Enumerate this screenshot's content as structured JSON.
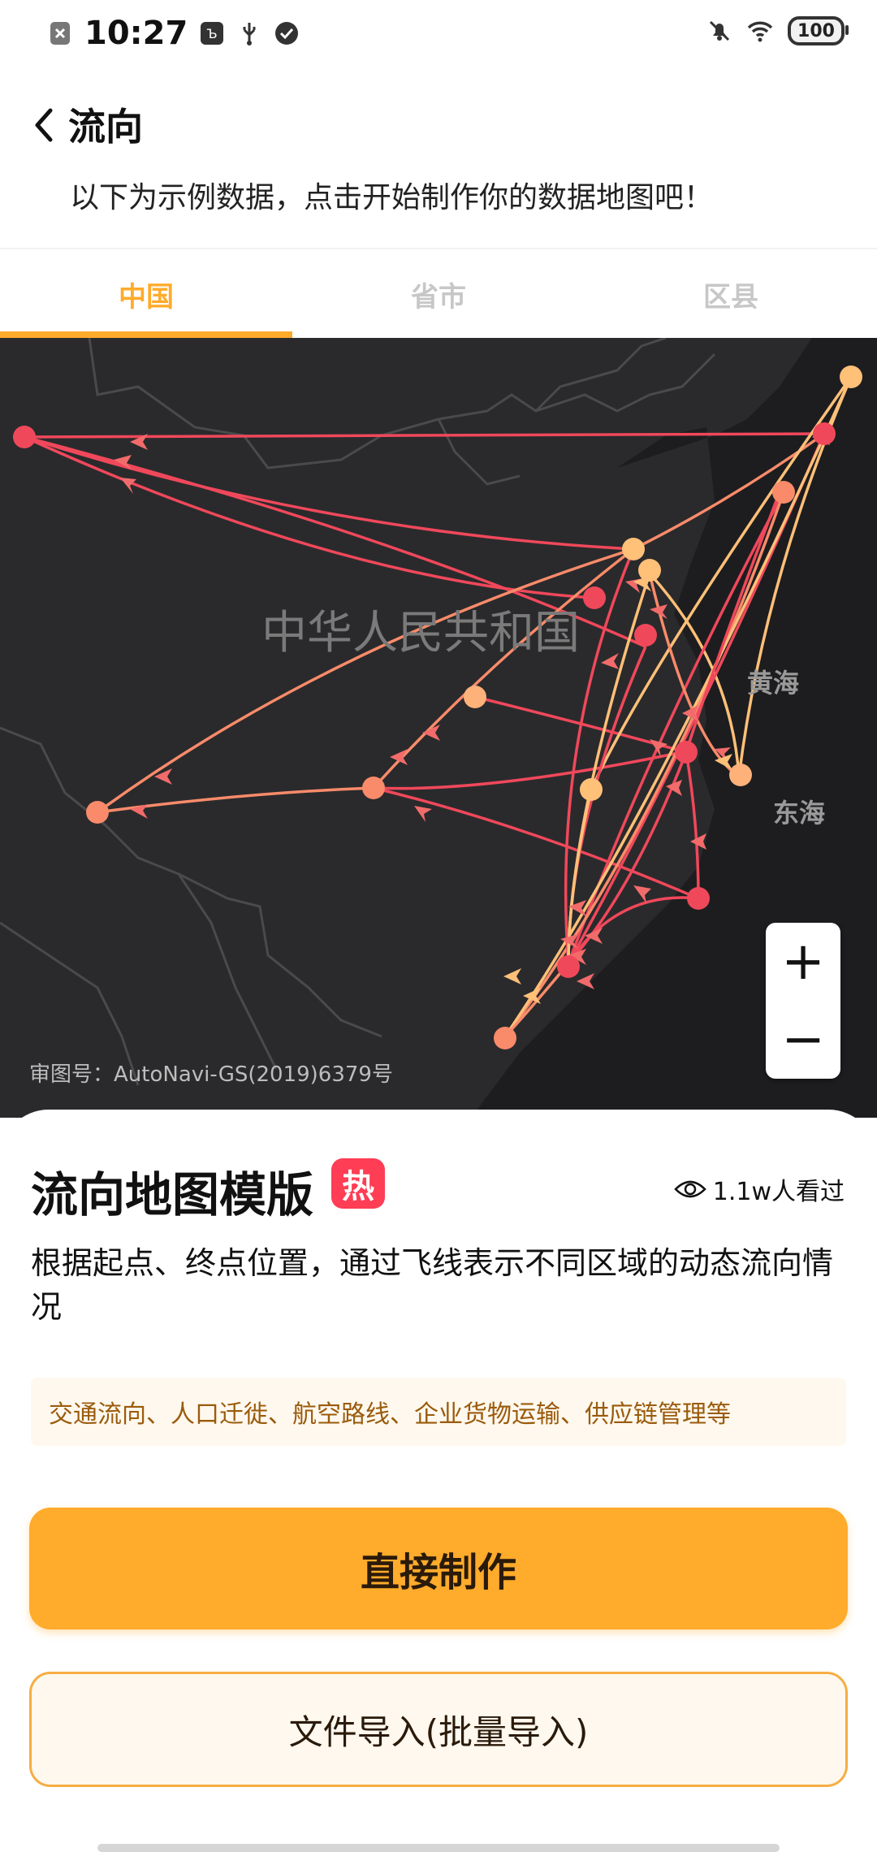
{
  "status_bar": {
    "time": "10:27",
    "battery": "100"
  },
  "header": {
    "title": "流向",
    "subtitle": "以下为示例数据，点击开始制作你的数据地图吧！"
  },
  "tabs": [
    {
      "label": "中国",
      "active": true
    },
    {
      "label": "省市",
      "active": false
    },
    {
      "label": "区县",
      "active": false
    }
  ],
  "map": {
    "country_label": "中华人民共和国",
    "sea_labels": [
      "黄海",
      "东海"
    ],
    "credit": "审图号：AutoNavi-GS(2019)6379号",
    "zoom_in": "+",
    "zoom_out": "−"
  },
  "template": {
    "title": "流向地图模版",
    "hot_badge": "热",
    "views": "1.1w人看过",
    "description": "根据起点、终点位置，通过飞线表示不同区域的动态流向情况",
    "use_cases": "交通流向、人口迁徙、航空路线、企业货物运输、供应链管理等"
  },
  "actions": {
    "primary": "直接制作",
    "secondary": "文件导入(批量导入)"
  },
  "colors": {
    "accent": "#ffab2b",
    "hot": "#ff3d55",
    "flow_red": "#f0485b",
    "flow_orange": "#f98b6a",
    "flow_light": "#ffc078"
  }
}
